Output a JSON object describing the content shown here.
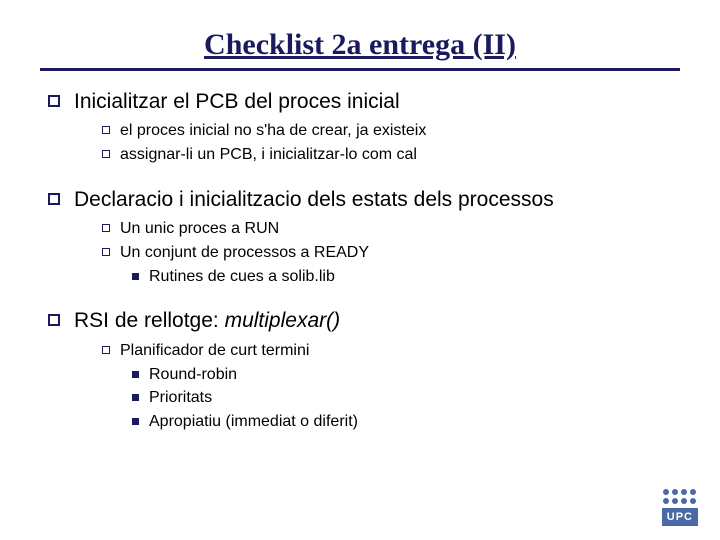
{
  "title": "Checklist 2a entrega (II)",
  "items": [
    {
      "text": "Inicialitzar el PCB del proces inicial",
      "children": [
        {
          "text": "el proces inicial no s'ha de crear, ja existeix"
        },
        {
          "text": "assignar-li un PCB, i inicialitzar-lo com cal"
        }
      ]
    },
    {
      "text": "Declaracio i inicialitzacio dels estats dels processos",
      "children": [
        {
          "text": "Un unic proces a RUN"
        },
        {
          "text": "Un conjunt de processos a READY",
          "children": [
            {
              "text": "Rutines de cues a solib.lib"
            }
          ]
        }
      ]
    },
    {
      "text_prefix": "RSI de rellotge: ",
      "text_italic": "multiplexar()",
      "children": [
        {
          "text": "Planificador de curt termini",
          "children": [
            {
              "text": "Round-robin"
            },
            {
              "text": "Prioritats"
            },
            {
              "text": "Apropiatiu (immediat o diferit)"
            }
          ]
        }
      ]
    }
  ],
  "logo": "UPC"
}
